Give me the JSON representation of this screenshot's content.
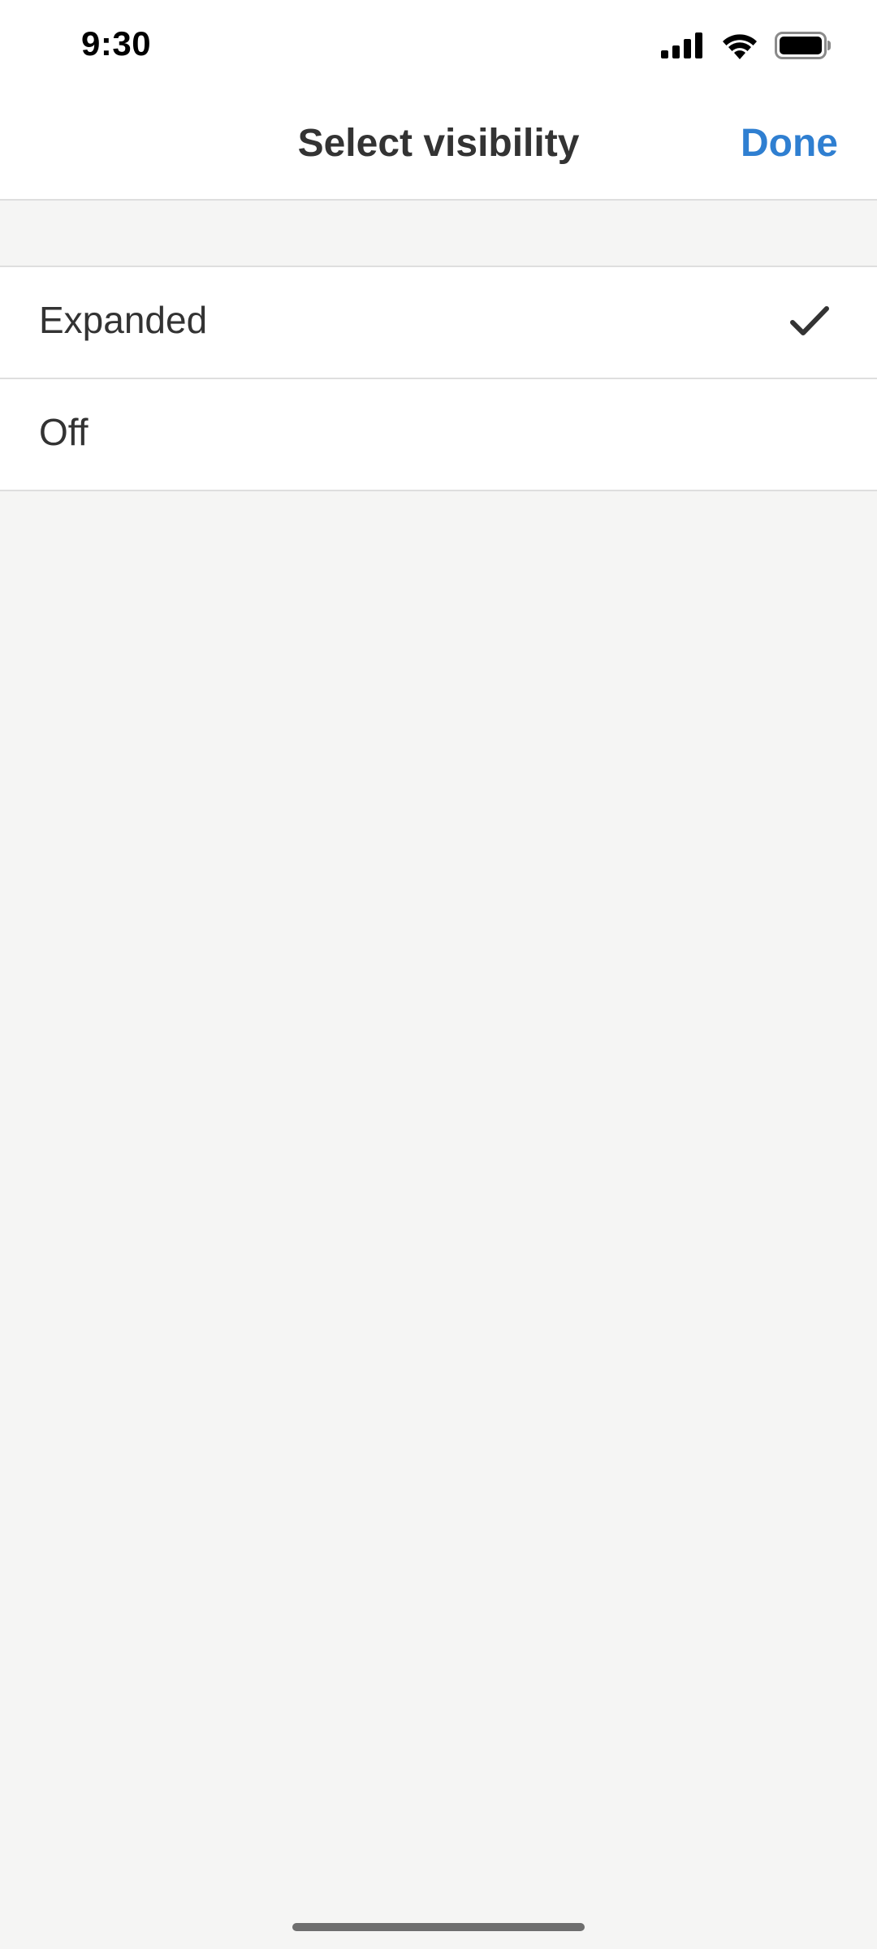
{
  "status_bar": {
    "time": "9:30",
    "icons": [
      "cellular-signal-icon",
      "wifi-icon",
      "battery-icon"
    ]
  },
  "nav": {
    "title": "Select visibility",
    "done_label": "Done"
  },
  "options": [
    {
      "label": "Expanded",
      "selected": true
    },
    {
      "label": "Off",
      "selected": false
    }
  ],
  "colors": {
    "accent": "#2f7fd1",
    "text": "#333333",
    "background": "#f5f5f4",
    "divider": "#dedede"
  }
}
